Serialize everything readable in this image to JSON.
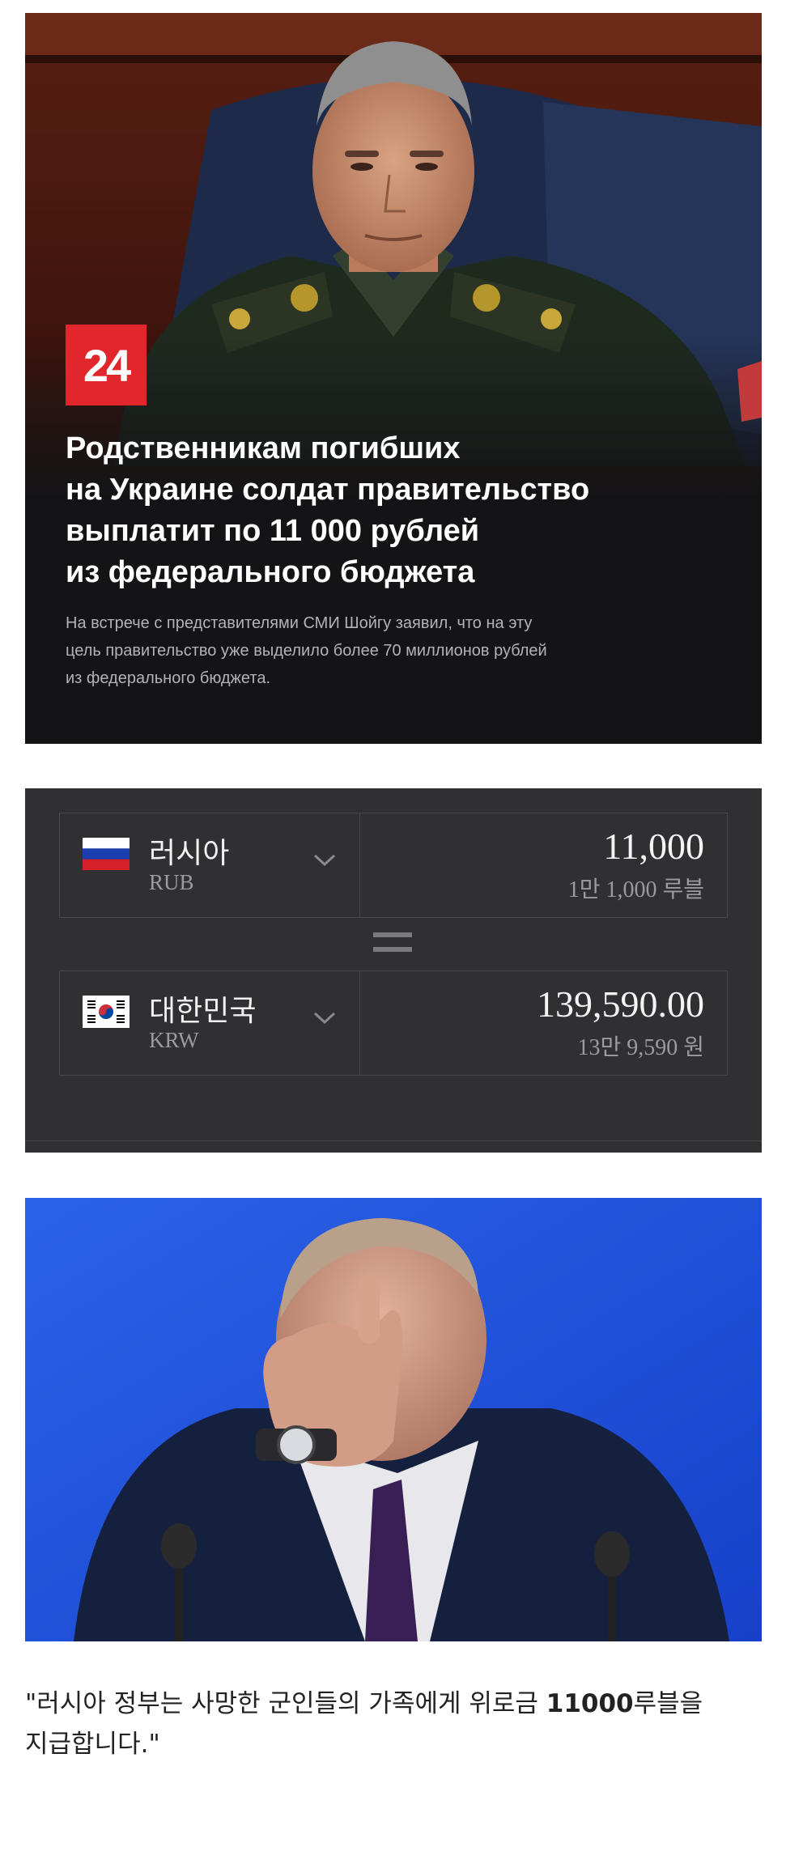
{
  "news": {
    "logo": "24",
    "headline": [
      "Родственникам погибших",
      "на Украине солдат правительство",
      "выплатит по 11 000 рублей",
      "из федерального бюджета"
    ],
    "subtext": [
      "На встрече с представителями СМИ Шойгу заявил, что на эту",
      "цель правительство уже выделило более 70 миллионов рублей",
      "из федерального бюджета."
    ]
  },
  "converter": {
    "from": {
      "country": "러시아",
      "code": "RUB",
      "amount": "11,000",
      "amount_korean": "1만 1,000 루블",
      "flag_icon": "russia-flag-icon"
    },
    "to": {
      "country": "대한민국",
      "code": "KRW",
      "amount": "139,590.00",
      "amount_korean": "13만 9,590 원",
      "flag_icon": "korea-flag-icon"
    },
    "colors": {
      "panel": "#303033",
      "border": "#48484c",
      "text": "#f1f1f1",
      "muted": "#9b9b9f"
    }
  },
  "caption": {
    "part1": "\"러시아 정부는 사망한 군인들의 가족에게 위로금 ",
    "bold": "11000",
    "part2": "루블을",
    "line2": "지급합니다.\""
  }
}
